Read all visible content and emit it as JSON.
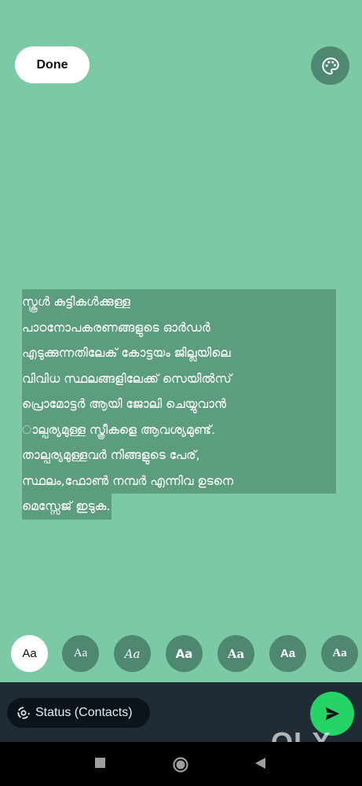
{
  "top": {
    "done_label": "Done",
    "palette_icon": "palette-icon"
  },
  "status_text": {
    "lines": [
      "സ്കൂൾ കുട്ടികൾക്കുള്ള",
      "പാഠനോപകരണങ്ങളുടെ ഓർഡർ",
      "എടുക്കുന്നതിലേക്  കോട്ടയം ജില്ലയിലെ",
      "വിവിധ സ്ഥലങ്ങളിലേക്ക് സെയിൽസ്",
      "പ്രൊമോട്ടർ ആയി ജോലി ചെയ്യുവാൻ",
      "ാല്പര്യമുള്ള സ്ത്രീകളെ ആവശ്യമുണ്ട്.",
      "താല്പര്യമുള്ളവർ നിങ്ങളുടെ പേര്,",
      "സ്ഥലം,ഫോൺ നമ്പർ എന്നിവ ഉടനെ",
      "മെസ്സേജ് ഇടുക."
    ],
    "text_color": "#ffffff",
    "highlight_color": "#5b9d7e"
  },
  "font_options": [
    {
      "label": "Aa",
      "selected": true
    },
    {
      "label": "Aa",
      "selected": false
    },
    {
      "label": "Aa",
      "selected": false
    },
    {
      "label": "Aa",
      "selected": false
    },
    {
      "label": "Aa",
      "selected": false
    },
    {
      "label": "Aa",
      "selected": false
    },
    {
      "label": "Aa",
      "selected": false
    }
  ],
  "bottom": {
    "audience_label": "Status (Contacts)",
    "audience_icon": "status-icon",
    "send_icon": "send-icon"
  },
  "watermark": "OLX",
  "colors": {
    "background": "#7bc9a5",
    "button_dark": "#4f8870",
    "send": "#25d366",
    "bar": "#1f2c33"
  }
}
